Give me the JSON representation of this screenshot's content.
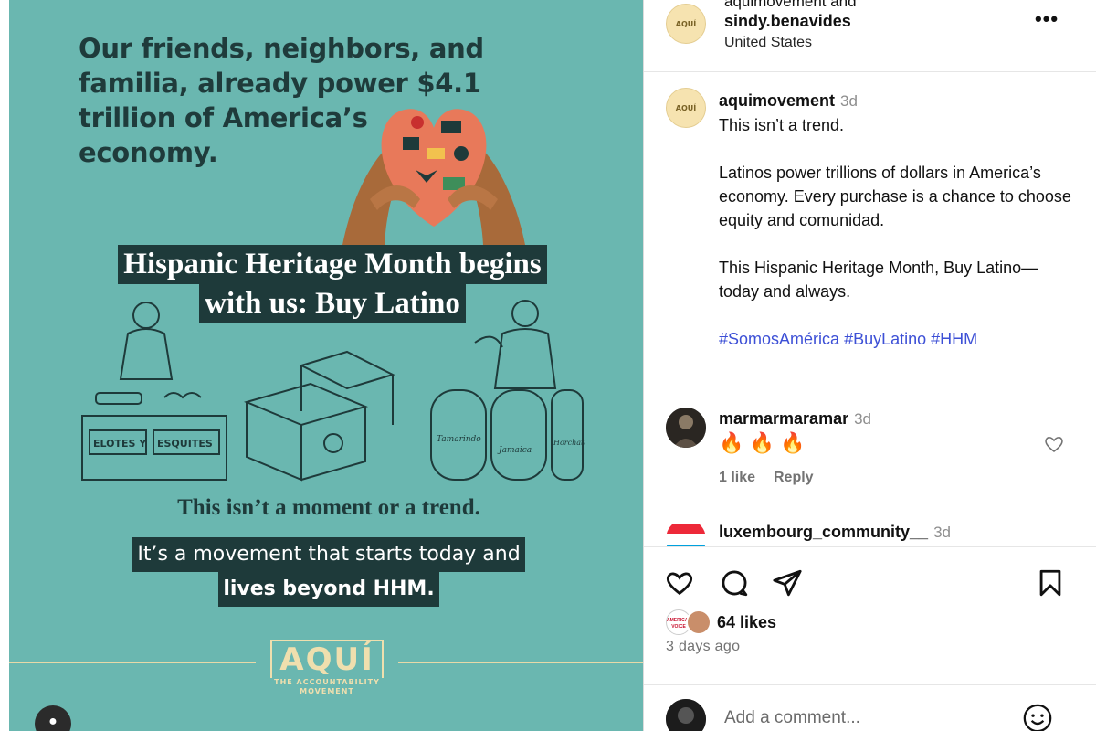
{
  "post_image": {
    "headline": "Our friends, neighbors, and familia, already power $4.1 trillion of America’s economy.",
    "banner_line1": "Hispanic Heritage Month begins",
    "banner_line2": "with us: Buy Latino",
    "stall_sign_left": "ELOTES Y",
    "stall_sign_right": "ESQUITES",
    "jar_labels": [
      "Tamarindo",
      "Jamaica",
      "Horchata"
    ],
    "moment_text": "This isn’t a moment or a trend.",
    "movement_line1": "It’s a movement that starts today and",
    "movement_line2": "lives beyond HHM.",
    "logo_word": "AQUÍ",
    "logo_sub1": "THE ACCOUNTABILITY",
    "logo_sub2": "MOVEMENT",
    "colors": {
      "background": "#6ab7b0",
      "dark": "#1e3a3a",
      "logo": "#efdfae"
    }
  },
  "header": {
    "owner": "aquimovement and",
    "collaborator": "sindy.benavides",
    "location": "United States",
    "avatar_text": "AQUÍ",
    "more_icon": "more-horizontal-icon"
  },
  "caption": {
    "username": "aquimovement",
    "time": "3d",
    "paragraphs": [
      "This isn’t a trend.",
      "Latinos power trillions of dollars in America’s economy. Every purchase is a chance to choose equity and comunidad.",
      "This Hispanic Heritage Month, Buy Latino—today and always."
    ],
    "hashtags": [
      "#SomosAmérica",
      "#BuyLatino",
      "#HHM"
    ]
  },
  "comments": [
    {
      "username": "marmarmaramar",
      "time": "3d",
      "text": "🔥 🔥 🔥",
      "likes": "1 like",
      "reply": "Reply"
    },
    {
      "username": "luxembourg_community__",
      "time": "3d"
    }
  ],
  "actions": {
    "icons": [
      "heart-icon",
      "comment-icon",
      "share-icon",
      "bookmark-icon"
    ],
    "likes": "64 likes",
    "date": "3 days ago",
    "liker_badge": "AMERICA'S VOICE"
  },
  "comment_box": {
    "placeholder": "Add a comment...",
    "emoji_icon": "smiley-icon"
  }
}
